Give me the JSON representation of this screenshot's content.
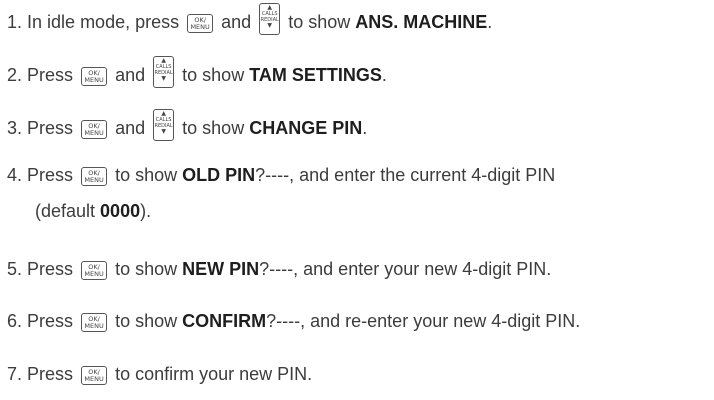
{
  "keys": {
    "ok_top": "OK/",
    "ok_bottom": "MENU",
    "nav_up_arrow": "▲",
    "nav_top": "CALLS",
    "nav_bottom": "REDIAL",
    "nav_down_arrow": "▼"
  },
  "steps": [
    {
      "num": "1.",
      "a": "In idle mode, press",
      "b": "and",
      "c": "to show",
      "bold": "ANS. MACHINE",
      "d": "."
    },
    {
      "num": "2.",
      "a": "Press",
      "b": "and",
      "c": "to show",
      "bold": "TAM SETTINGS",
      "d": "."
    },
    {
      "num": "3.",
      "a": "Press",
      "b": "and",
      "c": "to show",
      "bold": "CHANGE PIN",
      "d": "."
    },
    {
      "num": "4.",
      "a": "Press",
      "c": "to show",
      "bold": "OLD PIN",
      "d": "?----, and enter the current 4-digit PIN",
      "line2a": "(default ",
      "line2bold": "0000",
      "line2b": ")."
    },
    {
      "num": "5.",
      "a": "Press",
      "c": "to show",
      "bold": "NEW PIN",
      "d": "?----, and enter your new 4-digit PIN."
    },
    {
      "num": "6.",
      "a": "Press",
      "c": "to show",
      "bold": "CONFIRM",
      "d": "?----, and re-enter your new 4-digit PIN."
    },
    {
      "num": "7.",
      "a": "Press",
      "c": "to confirm your new PIN."
    }
  ]
}
